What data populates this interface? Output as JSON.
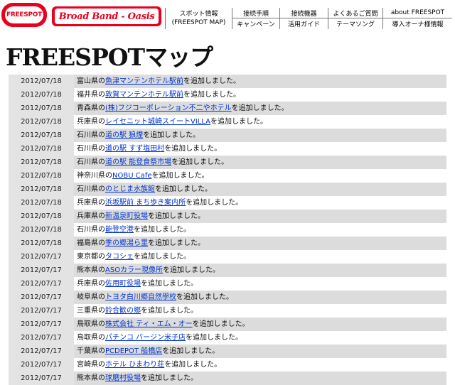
{
  "header": {
    "logo_text": "FREESPOT",
    "banner_text": "Broad Band - Oasis",
    "nav": {
      "spot_line1": "スポット情報",
      "spot_line2": "(FREESPOT MAP)",
      "connect_steps": "接続手順",
      "devices": "接続機器",
      "faq": "よくあるご質問",
      "about": "about FREESPOT",
      "campaign": "キャンペーン",
      "guide": "活用ガイド",
      "theme_song": "テーマソング",
      "owner_info": "導入オーナ様情報"
    }
  },
  "page_title": "FREESPOTマップ",
  "entries": [
    {
      "date": "2012/07/18",
      "pref": "富山県の",
      "place": "魚津マンテンホテル駅前",
      "suffix": "を追加しました。"
    },
    {
      "date": "2012/07/18",
      "pref": "福井県の",
      "place": "敦賀マンテンホテル駅前",
      "suffix": "を追加しました。"
    },
    {
      "date": "2012/07/18",
      "pref": "青森県の",
      "place": "(株)フジコーポレーション不二やホテル",
      "suffix": "を追加しました。"
    },
    {
      "date": "2012/07/18",
      "pref": "兵庫県の",
      "place": "レイセニット城崎スイートVILLA",
      "suffix": "を追加しました。"
    },
    {
      "date": "2012/07/18",
      "pref": "石川県の",
      "place": "道の駅 狼煙",
      "suffix": "を追加しました。"
    },
    {
      "date": "2012/07/18",
      "pref": "石川県の",
      "place": "道の駅 すず塩田村",
      "suffix": "を追加しました。"
    },
    {
      "date": "2012/07/18",
      "pref": "石川県の",
      "place": "道の駅 能登食祭市場",
      "suffix": "を追加しました。"
    },
    {
      "date": "2012/07/18",
      "pref": "神奈川県の",
      "place": "NOBU Cafe",
      "suffix": "を追加しました。"
    },
    {
      "date": "2012/07/18",
      "pref": "石川県の",
      "place": "のとじま水族館",
      "suffix": "を追加しました。"
    },
    {
      "date": "2012/07/18",
      "pref": "兵庫県の",
      "place": "浜坂駅前 まち歩き案内所",
      "suffix": "を追加しました。"
    },
    {
      "date": "2012/07/18",
      "pref": "兵庫県の",
      "place": "新温泉町役場",
      "suffix": "を追加しました。"
    },
    {
      "date": "2012/07/18",
      "pref": "石川県の",
      "place": "能登空港",
      "suffix": "を追加しました。"
    },
    {
      "date": "2012/07/18",
      "pref": "福島県の",
      "place": "季の郷湯ら里",
      "suffix": "を追加しました。"
    },
    {
      "date": "2012/07/17",
      "pref": "東京都の",
      "place": "タコシェ",
      "suffix": "を追加しました。"
    },
    {
      "date": "2012/07/17",
      "pref": "熊本県の",
      "place": "ASOカラー現像所",
      "suffix": "を追加しました。"
    },
    {
      "date": "2012/07/17",
      "pref": "兵庫県の",
      "place": "佐用町役場",
      "suffix": "を追加しました。"
    },
    {
      "date": "2012/07/17",
      "pref": "岐阜県の",
      "place": "トヨタ白川郷自然學校",
      "suffix": "を追加しました。"
    },
    {
      "date": "2012/07/17",
      "pref": "三重県の",
      "place": "鈴合歓の郷",
      "suffix": "を追加しました。"
    },
    {
      "date": "2012/07/17",
      "pref": "鳥取県の",
      "place": "株式会社 ティ・エム・オー",
      "suffix": "を追加しました。"
    },
    {
      "date": "2012/07/17",
      "pref": "鳥取県の",
      "place": "パチンコ バージン米子店",
      "suffix": "を追加しました。"
    },
    {
      "date": "2012/07/17",
      "pref": "千葉県の",
      "place": "PCDEPOT 船橋店",
      "suffix": "を追加しました。"
    },
    {
      "date": "2012/07/17",
      "pref": "宮崎県の",
      "place": "ホテル ひまわり荘",
      "suffix": "を追加しました。"
    },
    {
      "date": "2012/07/17",
      "pref": "熊本県の",
      "place": "球磨村役場",
      "suffix": "を追加しました。"
    }
  ]
}
